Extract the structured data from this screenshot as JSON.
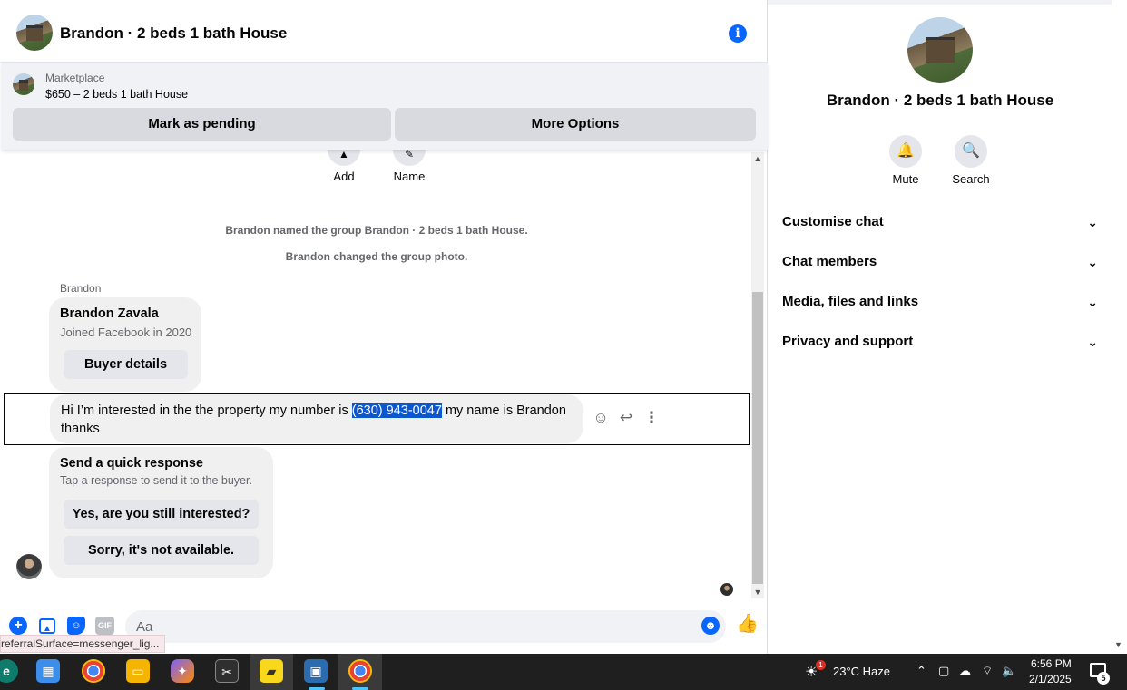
{
  "header": {
    "title": "Brandon · 2 beds 1 bath House",
    "info_icon": "i"
  },
  "marketplace": {
    "label": "Marketplace",
    "listing": "$650 – 2 beds 1 bath House",
    "pending_label": "Mark as pending",
    "options_label": "More Options"
  },
  "group_actions": {
    "add_label": "Add",
    "name_label": "Name"
  },
  "system_messages": [
    "Brandon named the group Brandon · 2 beds 1 bath House.",
    "Brandon changed the group photo."
  ],
  "buyer_card": {
    "sender": "Brandon",
    "name": "Brandon Zavala",
    "joined": "Joined Facebook in 2020",
    "details_label": "Buyer details"
  },
  "message": {
    "before": "Hi I’m interested in the the property my number is ",
    "highlight": "(630) 943-0047",
    "after": " my name is Brandon thanks"
  },
  "quick_response": {
    "title": "Send a quick response",
    "subtitle": "Tap a response to send it to the buyer.",
    "options": [
      "Yes, are you still interested?",
      "Sorry, it's not available."
    ]
  },
  "composer": {
    "placeholder": "Aa",
    "gif_label": "GIF"
  },
  "status_tooltip": "referralSurface=messenger_lig...",
  "panel": {
    "title": "Brandon · 2 beds 1 bath House",
    "mute_label": "Mute",
    "search_label": "Search",
    "sections": [
      "Customise chat",
      "Chat members",
      "Media, files and links",
      "Privacy and support"
    ]
  },
  "taskbar": {
    "weather_badge": "1",
    "weather": "23°C  Haze",
    "time": "6:56 PM",
    "date": "2/1/2025",
    "notification_count": "5"
  },
  "colors": {
    "accent": "#0866ff",
    "highlight": "#0b57d0",
    "bubble": "#f0f0f0"
  }
}
